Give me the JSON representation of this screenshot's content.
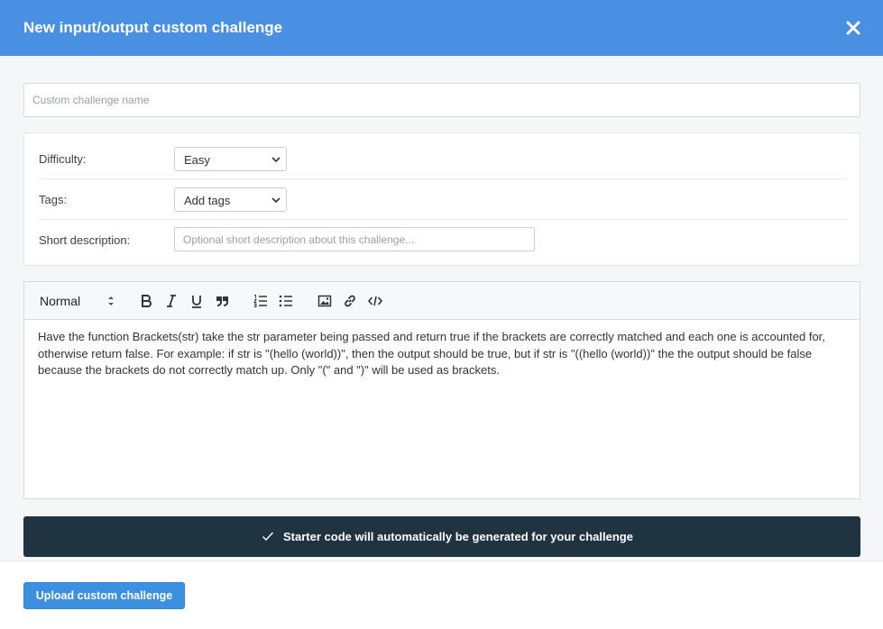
{
  "modal": {
    "title": "New input/output custom challenge",
    "close_icon": "close-icon"
  },
  "name_field": {
    "placeholder": "Custom challenge name",
    "value": ""
  },
  "properties": {
    "difficulty": {
      "label": "Difficulty:",
      "selected": "Easy"
    },
    "tags": {
      "label": "Tags:",
      "selected": "Add tags"
    },
    "short_description": {
      "label": "Short description:",
      "placeholder": "Optional short description about this challenge...",
      "value": ""
    }
  },
  "editor": {
    "format_select": "Normal",
    "toolbar_icons": [
      "bold-icon",
      "italic-icon",
      "underline-icon",
      "quote-icon",
      "ordered-list-icon",
      "bullet-list-icon",
      "image-icon",
      "link-icon",
      "code-icon"
    ],
    "body_text": "Have the function Brackets(str) take the str parameter being passed and return true if the brackets are correctly matched and each one is accounted for, otherwise return false. For example: if str is \"(hello (world))\", then the output should be true, but if str is \"((hello (world))\" the the output should be false because the brackets do not correctly match up. Only \"(\" and \")\" will be used as brackets."
  },
  "banner": {
    "icon": "check-icon",
    "text": "Starter code will automatically be generated for your challenge"
  },
  "footer": {
    "upload_label": "Upload custom challenge"
  },
  "colors": {
    "header": "#4a90e2",
    "banner": "#1f3341",
    "primary_button": "#3d8fe0"
  }
}
